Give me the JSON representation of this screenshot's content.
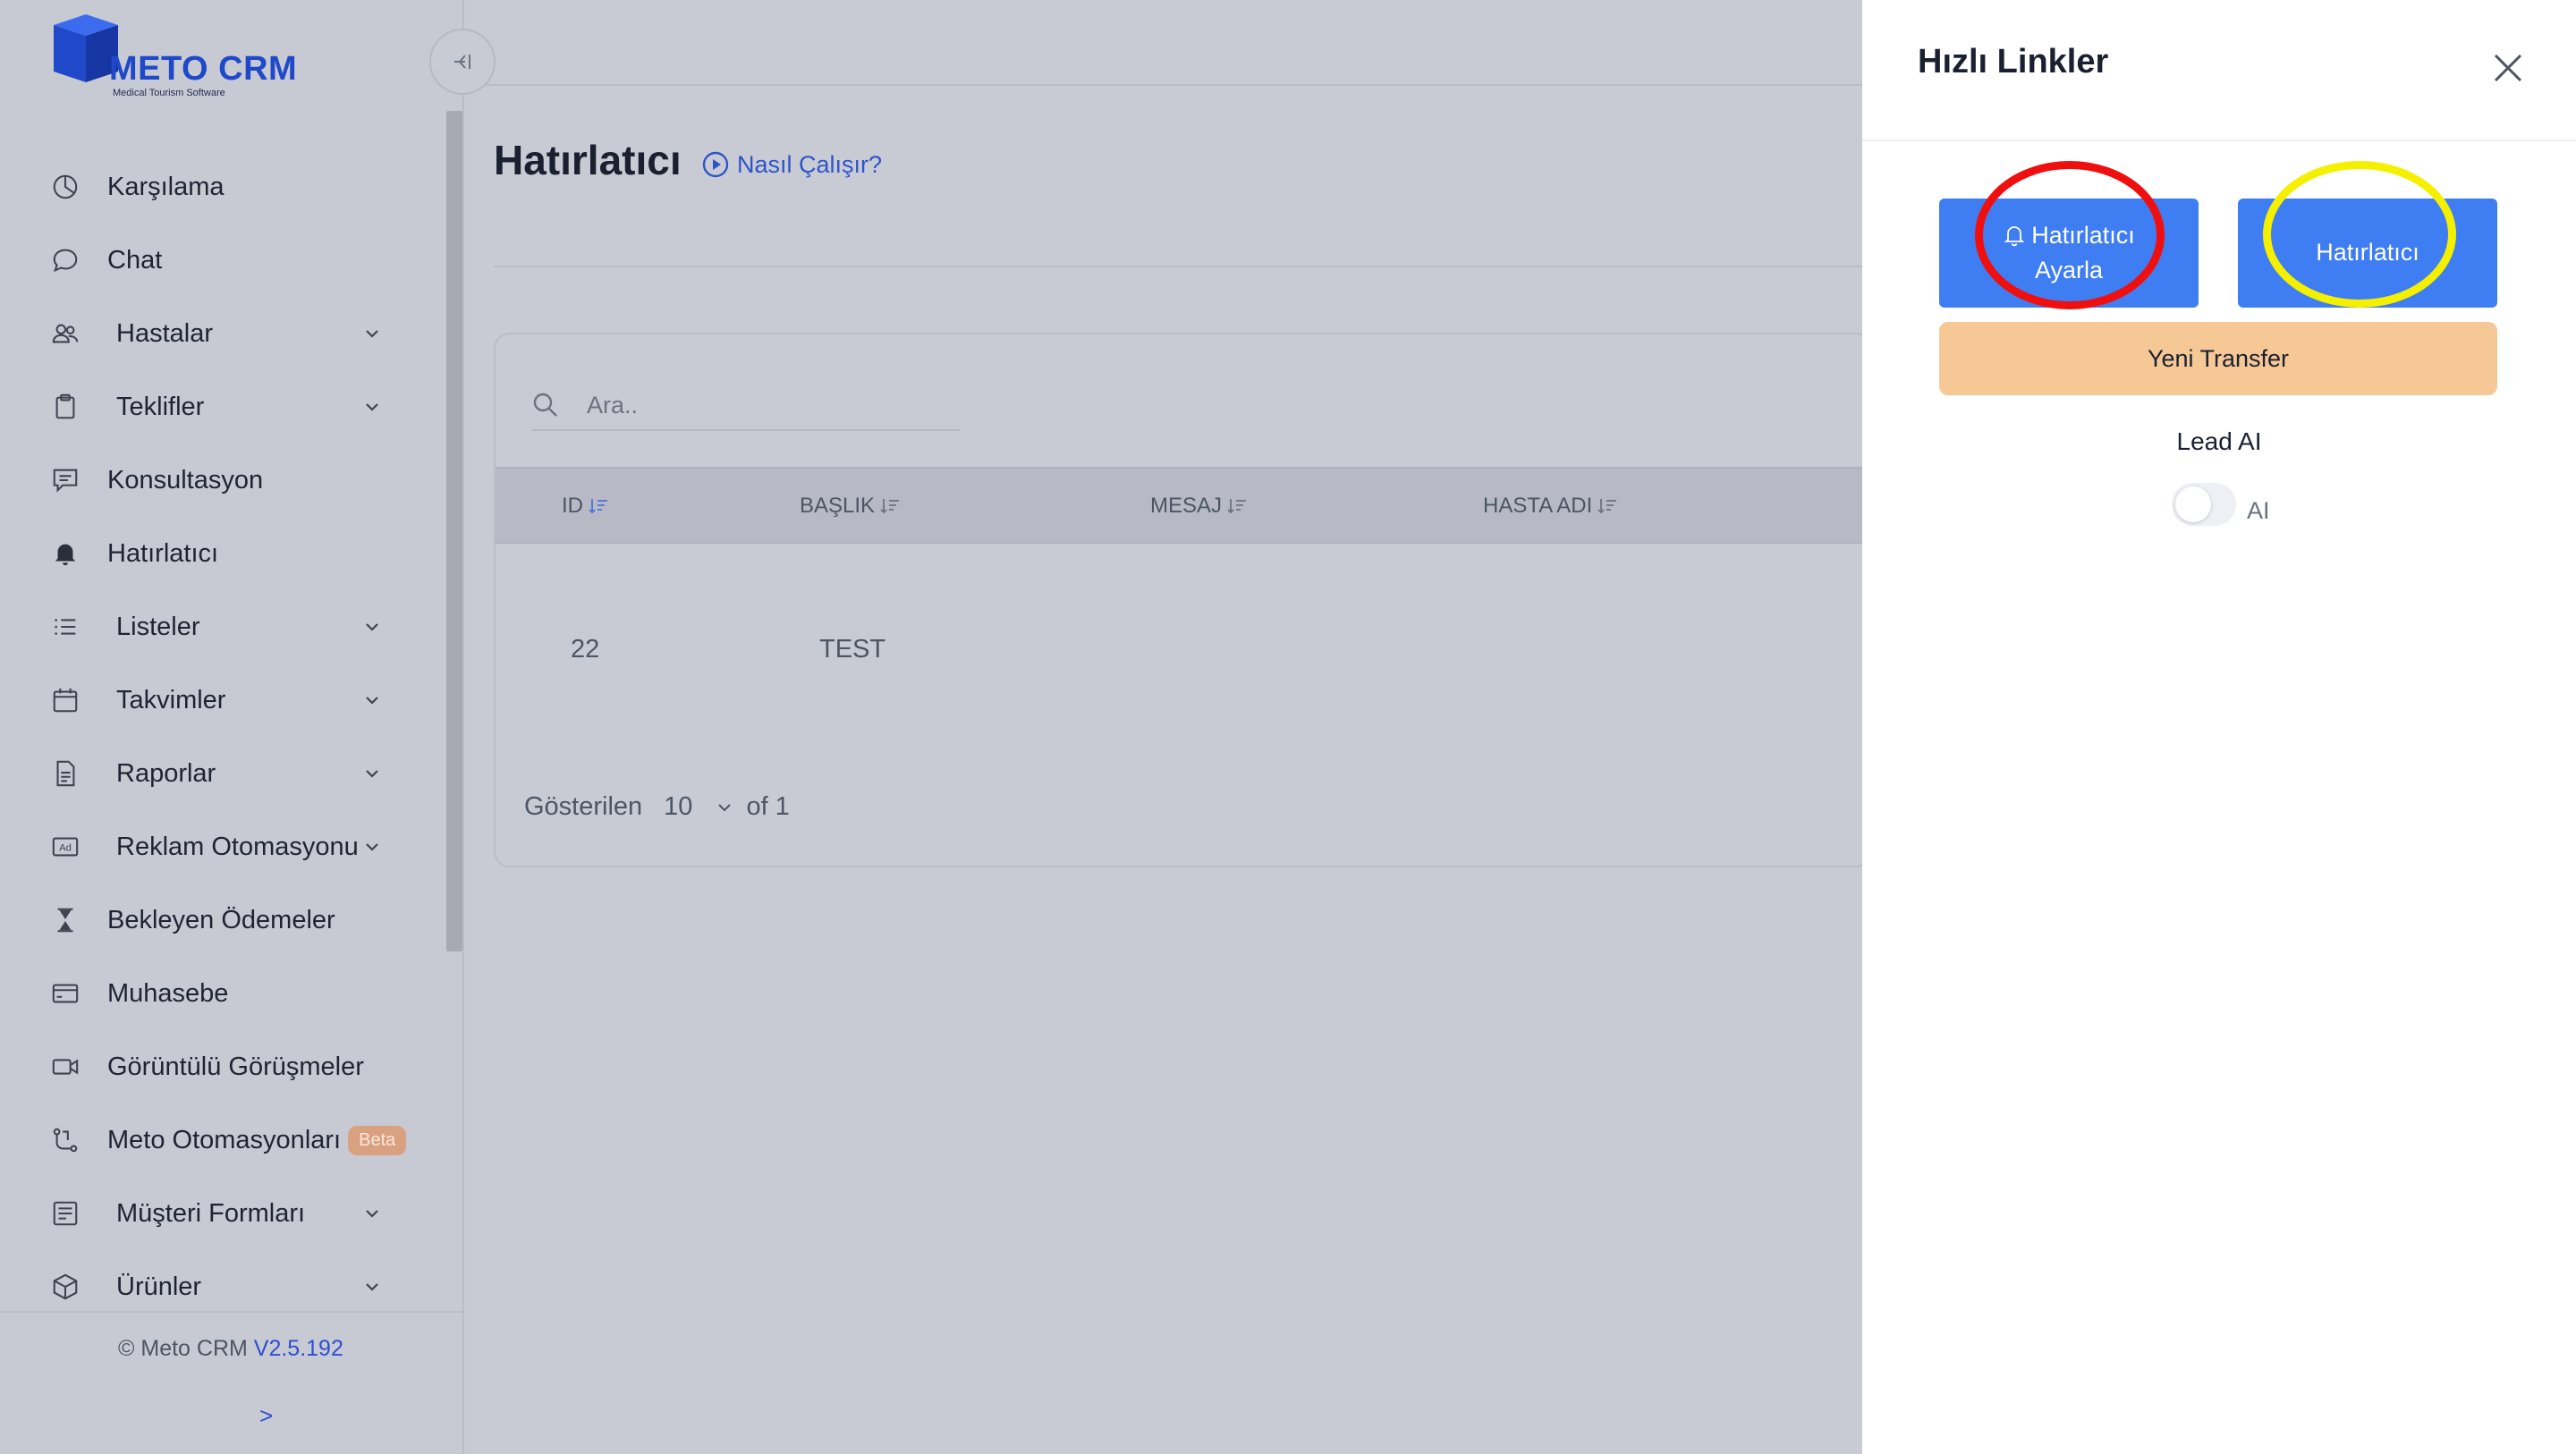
{
  "brand": {
    "name": "METO CRM",
    "tagline": "Medical Tourism Software"
  },
  "sidebar": {
    "items": [
      {
        "label": "Karşılama",
        "icon": "dashboard-icon",
        "expandable": false
      },
      {
        "label": "Chat",
        "icon": "chat-bubble-icon",
        "expandable": false
      },
      {
        "label": "Hastalar",
        "icon": "users-icon",
        "expandable": true
      },
      {
        "label": "Teklifler",
        "icon": "clipboard-icon",
        "expandable": true
      },
      {
        "label": "Konsultasyon",
        "icon": "message-square-icon",
        "expandable": false
      },
      {
        "label": "Hatırlatıcı",
        "icon": "bell-icon",
        "expandable": false,
        "active": true
      },
      {
        "label": "Listeler",
        "icon": "list-icon",
        "expandable": true
      },
      {
        "label": "Takvimler",
        "icon": "calendar-icon",
        "expandable": true
      },
      {
        "label": "Raporlar",
        "icon": "document-icon",
        "expandable": true
      },
      {
        "label": "Reklam Otomasyonu",
        "icon": "ad-icon",
        "expandable": true
      },
      {
        "label": "Bekleyen Ödemeler",
        "icon": "hourglass-icon",
        "expandable": false
      },
      {
        "label": "Muhasebe",
        "icon": "credit-card-icon",
        "expandable": false
      },
      {
        "label": "Görüntülü Görüşmeler",
        "icon": "video-icon",
        "expandable": false
      },
      {
        "label": "Meto Otomasyonları",
        "icon": "flow-icon",
        "expandable": false,
        "badge": "Beta"
      },
      {
        "label": "Müşteri Formları",
        "icon": "form-icon",
        "expandable": true
      },
      {
        "label": "Ürünler",
        "icon": "box-icon",
        "expandable": true
      }
    ],
    "footer": {
      "copyright": "© Meto CRM",
      "version": "V2.5.192",
      "expand_label": ">"
    }
  },
  "page": {
    "title": "Hatırlatıcı",
    "how_it_works": "Nasıl Çalışır?",
    "search_placeholder": "Ara..",
    "table": {
      "columns": [
        "ID",
        "BAŞLIK",
        "MESAJ",
        "HASTA ADI"
      ],
      "rows": [
        {
          "id": "22",
          "title": "TEST",
          "message": "",
          "patient": ""
        }
      ]
    },
    "pagination": {
      "shown_label": "Gösterilen",
      "page_size": "10",
      "of_label": "of 1"
    }
  },
  "quick_links": {
    "title": "Hızlı Linkler",
    "set_reminder_line1": "Hatırlatıcı",
    "set_reminder_line2": "Ayarla",
    "reminder_label": "Hatırlatıcı",
    "new_transfer_label": "Yeni Transfer",
    "lead_ai_label": "Lead AI",
    "ai_toggle_label": "AI",
    "ai_toggle_on": false
  },
  "colors": {
    "brand_blue": "#1f49c9",
    "button_blue": "#3f7df3",
    "transfer_orange": "#f6c896",
    "link_blue": "#2d55c9",
    "beta_badge": "#d9a17f",
    "annotation_red": "#f00f0f",
    "annotation_yellow": "#f4f000"
  }
}
